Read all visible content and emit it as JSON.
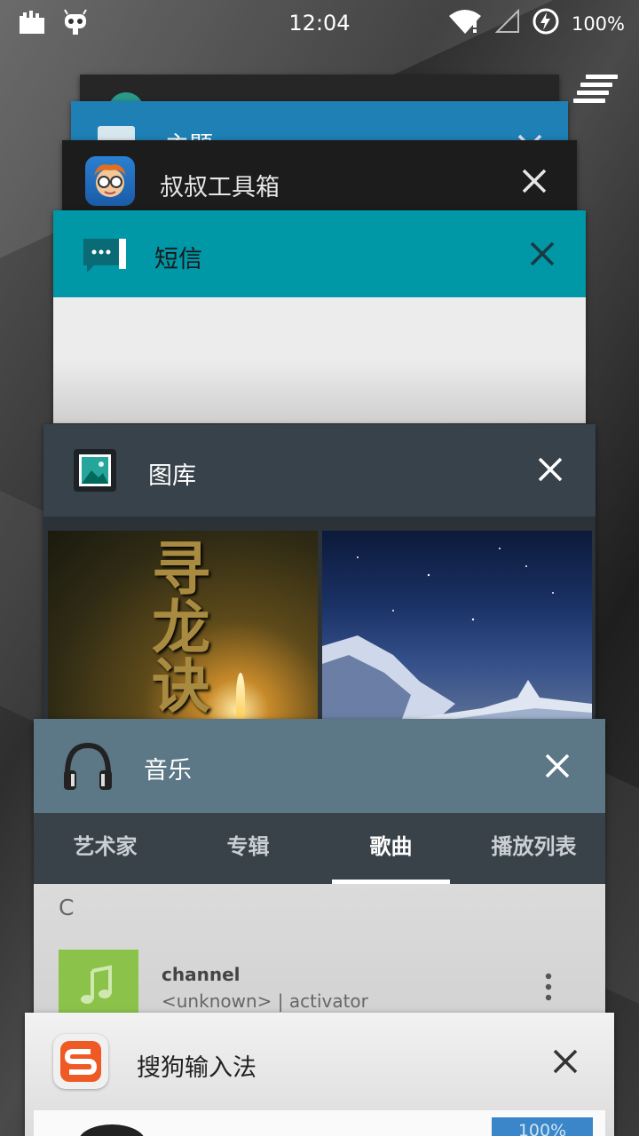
{
  "status_bar": {
    "time": "12:04",
    "battery": "100%"
  },
  "cards": {
    "theme": {
      "title": "主题"
    },
    "toolbox": {
      "title": "叔叔工具箱"
    },
    "sms": {
      "title": "短信"
    },
    "gallery": {
      "title": "图库",
      "album_cover_text": "寻龙诀"
    },
    "music": {
      "title": "音乐",
      "tabs": [
        "艺术家",
        "专辑",
        "歌曲",
        "播放列表"
      ],
      "active_tab": "歌曲",
      "section_letter": "C",
      "song": {
        "title": "channel",
        "subtitle": "<unknown> | activator"
      }
    },
    "sogou": {
      "title": "搜狗输入法",
      "partial_badge": "100%"
    }
  }
}
